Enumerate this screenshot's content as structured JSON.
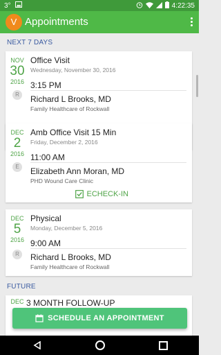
{
  "status_bar": {
    "left_text": "3°",
    "time": "4:22:35",
    "icons": [
      "image-icon",
      "alarm-icon",
      "wifi-icon",
      "signal-icon",
      "battery-icon"
    ]
  },
  "app_bar": {
    "avatar_letter": "V",
    "title": "Appointments",
    "overflow_icon": "more-vert-icon"
  },
  "sections": {
    "next7": "NEXT 7 DAYS",
    "future": "FUTURE"
  },
  "appointments": [
    {
      "month": "NOV",
      "day": "30",
      "year": "2016",
      "type": "Office Visit",
      "full_date": "Wednesday, November 30, 2016",
      "time": "3:15 PM",
      "provider_initial": "R",
      "provider": "Richard L Brooks, MD",
      "clinic": "Family Healthcare of Rockwall"
    },
    {
      "month": "DEC",
      "day": "2",
      "year": "2016",
      "type": "Amb Office Visit 15 Min",
      "full_date": "Friday, December 2, 2016",
      "time": "11:00 AM",
      "provider_initial": "E",
      "provider": "Elizabeth Ann Moran, MD",
      "clinic": "PHD Wound Care Clinic",
      "action": "ECHECK-IN"
    },
    {
      "month": "DEC",
      "day": "5",
      "year": "2016",
      "type": "Physical",
      "full_date": "Monday, December 5, 2016",
      "time": "9:00 AM",
      "provider_initial": "R",
      "provider": "Richard L Brooks, MD",
      "clinic": "Family Healthcare of Rockwall"
    },
    {
      "month": "DEC",
      "type": "3 MONTH FOLLOW-UP"
    }
  ],
  "fab": {
    "label": "SCHEDULE AN APPOINTMENT",
    "icon": "calendar-icon"
  },
  "nav_bar": {
    "icons": [
      "back-icon",
      "home-icon",
      "recents-icon"
    ]
  }
}
